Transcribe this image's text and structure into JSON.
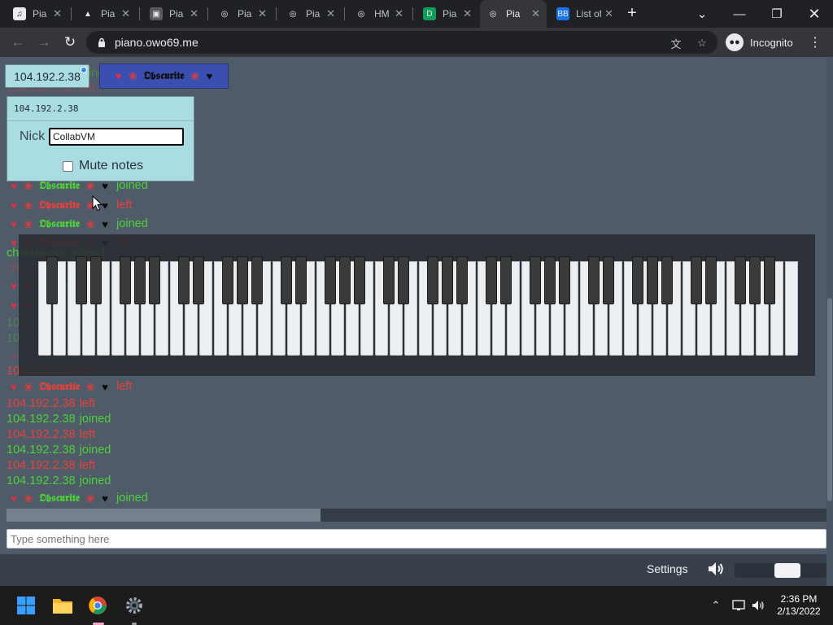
{
  "browser": {
    "tabs": [
      {
        "label": "Pia",
        "favicon": "piano-icon",
        "active": false
      },
      {
        "label": "Pia",
        "favicon": "hat-icon",
        "active": false
      },
      {
        "label": "Pia",
        "favicon": "image-icon",
        "active": false
      },
      {
        "label": "Pia",
        "favicon": "globe-icon",
        "active": false
      },
      {
        "label": "Pia",
        "favicon": "globe-icon",
        "active": false
      },
      {
        "label": "HM",
        "favicon": "globe-icon",
        "active": false
      },
      {
        "label": "Pia",
        "favicon": "d-logo-icon",
        "active": false
      },
      {
        "label": "Pia",
        "favicon": "globe-icon",
        "active": true
      },
      {
        "label": "List of M",
        "favicon": "bb-icon",
        "active": false
      }
    ],
    "url": "piano.owo69.me",
    "incognito_label": "Incognito"
  },
  "page": {
    "my_chip": {
      "ip": "104.192.2.38"
    },
    "other_chip": {
      "name": "𝕺𝖇𝖘𝖈𝖚𝖗𝖎𝖙𝖊"
    },
    "nick_popup": {
      "ip": "104.192.2.38",
      "nick_label": "Nick",
      "nick_value": "CollabVM",
      "mute_label": "Mute notes",
      "mute_checked": false
    },
    "chat": [
      {
        "name": "104.192.2.38",
        "fancy": false,
        "action": "joined",
        "status": "ok"
      },
      {
        "name": "104.192.2.38",
        "fancy": false,
        "action": "left",
        "status": "bad"
      },
      {
        "name": "𝕺𝖇𝖘𝖈𝖚𝖗𝖎𝖙𝖊",
        "fancy": true,
        "action": "joined",
        "status": "ok"
      },
      {
        "name": "𝕺𝖇𝖘𝖈𝖚𝖗𝖎𝖙𝖊",
        "fancy": true,
        "action": "left",
        "status": "bad"
      },
      {
        "name": "𝕺𝖇𝖘𝖈𝖚𝖗𝖎𝖙𝖊",
        "fancy": true,
        "action": "joined",
        "status": "ok"
      },
      {
        "name": "𝕺𝖇𝖘𝖈𝖚𝖗𝖎𝖙𝖊",
        "fancy": true,
        "action": "left",
        "status": "bad"
      },
      {
        "name": "chotato-pan",
        "fancy": false,
        "action": "joined",
        "status": "ok"
      },
      {
        "name": "chot",
        "fancy": false,
        "action": "",
        "status": "bad"
      },
      {
        "name": "𝕺𝖇𝖘𝖈𝖚𝖗𝖎𝖙𝖊",
        "fancy": true,
        "action": "joined",
        "status": "ok"
      },
      {
        "name": "𝕺𝖇𝖘𝖈𝖚𝖗𝖎𝖙𝖊",
        "fancy": true,
        "action": "left",
        "status": "bad"
      },
      {
        "name": "104.192.2.38",
        "fancy": false,
        "action": "joined",
        "status": "ok"
      },
      {
        "name": "104.192.2.38",
        "fancy": false,
        "action": "joined",
        "status": "ok"
      },
      {
        "name": "𝕺𝖇𝖘𝖈𝖚𝖗𝖎𝖙𝖊",
        "fancy": true,
        "action": "joined",
        "status": "ok"
      },
      {
        "name": "104.192.2.38",
        "fancy": false,
        "action": "left",
        "status": "bad"
      },
      {
        "name": "𝕺𝖇𝖘𝖈𝖚𝖗𝖎𝖙𝖊",
        "fancy": true,
        "action": "left",
        "status": "bad"
      },
      {
        "name": "104.192.2.38",
        "fancy": false,
        "action": "left",
        "status": "bad"
      },
      {
        "name": "104.192.2.38",
        "fancy": false,
        "action": "joined",
        "status": "ok"
      },
      {
        "name": "104.192.2.38",
        "fancy": false,
        "action": "left",
        "status": "bad"
      },
      {
        "name": "104.192.2.38",
        "fancy": false,
        "action": "joined",
        "status": "ok"
      },
      {
        "name": "104.192.2.38",
        "fancy": false,
        "action": "left",
        "status": "bad"
      },
      {
        "name": "104.192.2.38",
        "fancy": false,
        "action": "joined",
        "status": "ok"
      },
      {
        "name": "𝕺𝖇𝖘𝖈𝖚𝖗𝖎𝖙𝖊",
        "fancy": true,
        "action": "joined",
        "status": "ok"
      }
    ],
    "piano": {
      "white_key_count": 52,
      "black_key_count": 36
    },
    "chat_input_placeholder": "Type something here",
    "settings_label": "Settings",
    "volume_level": 0.6
  },
  "taskbar": {
    "time": "2:36 PM",
    "date": "2/13/2022",
    "apps": [
      "windows-start-icon",
      "file-explorer-icon",
      "chrome-icon",
      "settings-gear-icon"
    ]
  },
  "colors": {
    "joined": "#4cd137",
    "left": "#e8413c",
    "page_background": "#4f5b69",
    "chip_background": "#a9dde2"
  }
}
